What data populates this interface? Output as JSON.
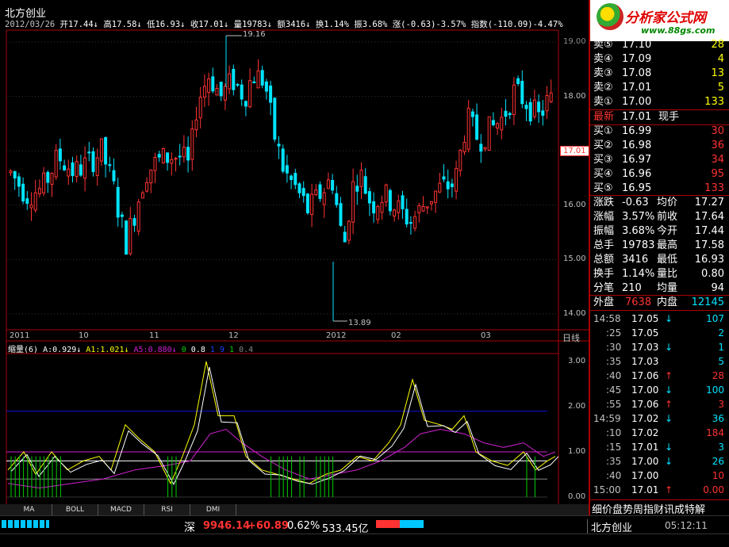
{
  "stock": {
    "name": "北方创业"
  },
  "info_bar": {
    "date": "2012/03/26",
    "open": "开17.44↓",
    "high": "高17.58↓",
    "low": "低16.93↓",
    "close": "收17.01↓",
    "volume": "量19783↓",
    "amount": "额3416↓",
    "turnover": "换1.14%",
    "amplitude": "振3.68%",
    "change": "涨(-0.63)-3.57%",
    "index": "指数(-110.09)-4.47%"
  },
  "logo": {
    "title": "分析家公式网",
    "url": "www.88gs.com"
  },
  "price_axis": [
    "19.00",
    "18.00",
    "17.00",
    "16.00",
    "15.00",
    "14.00"
  ],
  "current_price_tag": "17.01",
  "annotations": {
    "high": "19.16",
    "low": "13.89"
  },
  "time_axis": {
    "labels": [
      "2011",
      "10",
      "11",
      "12",
      "2012",
      "02",
      "03"
    ],
    "period": "日线"
  },
  "indicator": {
    "title": "缩量(6)",
    "a": "A:0.929↓",
    "a1": "A1:1.021↓",
    "a5": "A5:0.880↓",
    "c0": "0",
    "c1": "0.8",
    "c2": "1",
    "c3": "9",
    "c4": "1",
    "c5": "0.4",
    "axis": [
      "3.00",
      "2.00",
      "1.00",
      "0.00"
    ]
  },
  "tabs": [
    "MA",
    "BOLL",
    "MACD",
    "RSI",
    "DMI"
  ],
  "quote_panel": {
    "sells": [
      {
        "label": "卖⑤",
        "price": "17.10",
        "vol": "28"
      },
      {
        "label": "卖④",
        "price": "17.09",
        "vol": "4"
      },
      {
        "label": "卖③",
        "price": "17.08",
        "vol": "13"
      },
      {
        "label": "卖②",
        "price": "17.01",
        "vol": "5"
      },
      {
        "label": "卖①",
        "price": "17.00",
        "vol": "133"
      }
    ],
    "latest": {
      "label": "最新",
      "price": "17.01",
      "sub": "现手"
    },
    "buys": [
      {
        "label": "买①",
        "price": "16.99",
        "vol": "30"
      },
      {
        "label": "买②",
        "price": "16.98",
        "vol": "36"
      },
      {
        "label": "买③",
        "price": "16.97",
        "vol": "34"
      },
      {
        "label": "买④",
        "price": "16.96",
        "vol": "95"
      },
      {
        "label": "买⑤",
        "price": "16.95",
        "vol": "133"
      }
    ],
    "stats": [
      {
        "l1": "涨跌",
        "v1": "-0.63",
        "l2": "均价",
        "v2": "17.27"
      },
      {
        "l1": "涨幅",
        "v1": "3.57%",
        "l2": "前收",
        "v2": "17.64"
      },
      {
        "l1": "振幅",
        "v1": "3.68%",
        "l2": "今开",
        "v2": "17.44"
      },
      {
        "l1": "总手",
        "v1": "19783",
        "l2": "最高",
        "v2": "17.58"
      },
      {
        "l1": "总额",
        "v1": "3416",
        "l2": "最低",
        "v2": "16.93"
      },
      {
        "l1": "换手",
        "v1": "1.14%",
        "l2": "量比",
        "v2": "0.80"
      },
      {
        "l1": "分笔",
        "v1": "210",
        "l2": "均量",
        "v2": "94"
      }
    ],
    "outer": {
      "l1": "外盘",
      "v1": "7638",
      "l2": "内盘",
      "v2": "12145"
    },
    "ticks": [
      {
        "time": "14:58",
        "price": "17.05",
        "dir": "↓",
        "vol": "107",
        "c": "dn"
      },
      {
        "time": ":25",
        "price": "17.05",
        "dir": "",
        "vol": "2",
        "c": "dn"
      },
      {
        "time": ":30",
        "price": "17.03",
        "dir": "↓",
        "vol": "1",
        "c": "dn"
      },
      {
        "time": ":35",
        "price": "17.03",
        "dir": "",
        "vol": "5",
        "c": "dn"
      },
      {
        "time": ":40",
        "price": "17.06",
        "dir": "↑",
        "vol": "28",
        "c": "up"
      },
      {
        "time": ":45",
        "price": "17.00",
        "dir": "↓",
        "vol": "100",
        "c": "dn"
      },
      {
        "time": ":55",
        "price": "17.06",
        "dir": "↑",
        "vol": "3",
        "c": "up"
      },
      {
        "time": "14:59",
        "price": "17.02",
        "dir": "↓",
        "vol": "36",
        "c": "dn"
      },
      {
        "time": ":10",
        "price": "17.02",
        "dir": "",
        "vol": "184",
        "c": "up"
      },
      {
        "time": ":15",
        "price": "17.01",
        "dir": "↓",
        "vol": "3",
        "c": "dn"
      },
      {
        "time": ":35",
        "price": "17.00",
        "dir": "↓",
        "vol": "26",
        "c": "dn"
      },
      {
        "time": ":40",
        "price": "17.00",
        "dir": "",
        "vol": "10",
        "c": "up"
      },
      {
        "time": "15:00",
        "price": "17.01",
        "dir": "↑",
        "vol": "0.00",
        "c": "up"
      }
    ],
    "bottom_tabs": "细价盘势周指财讯成特解"
  },
  "status_bar": {
    "market": "深",
    "index": "9946.14",
    "change": "+60.89",
    "percent": "0.62%",
    "amount": "533.45亿",
    "stock": "北方创业",
    "time": "05:12:11"
  },
  "colors": {
    "up": "#ff3232",
    "down": "#00e4ff",
    "yellow": "#ffff00",
    "magenta": "#d020d0",
    "blue_line": "#1010c8"
  }
}
